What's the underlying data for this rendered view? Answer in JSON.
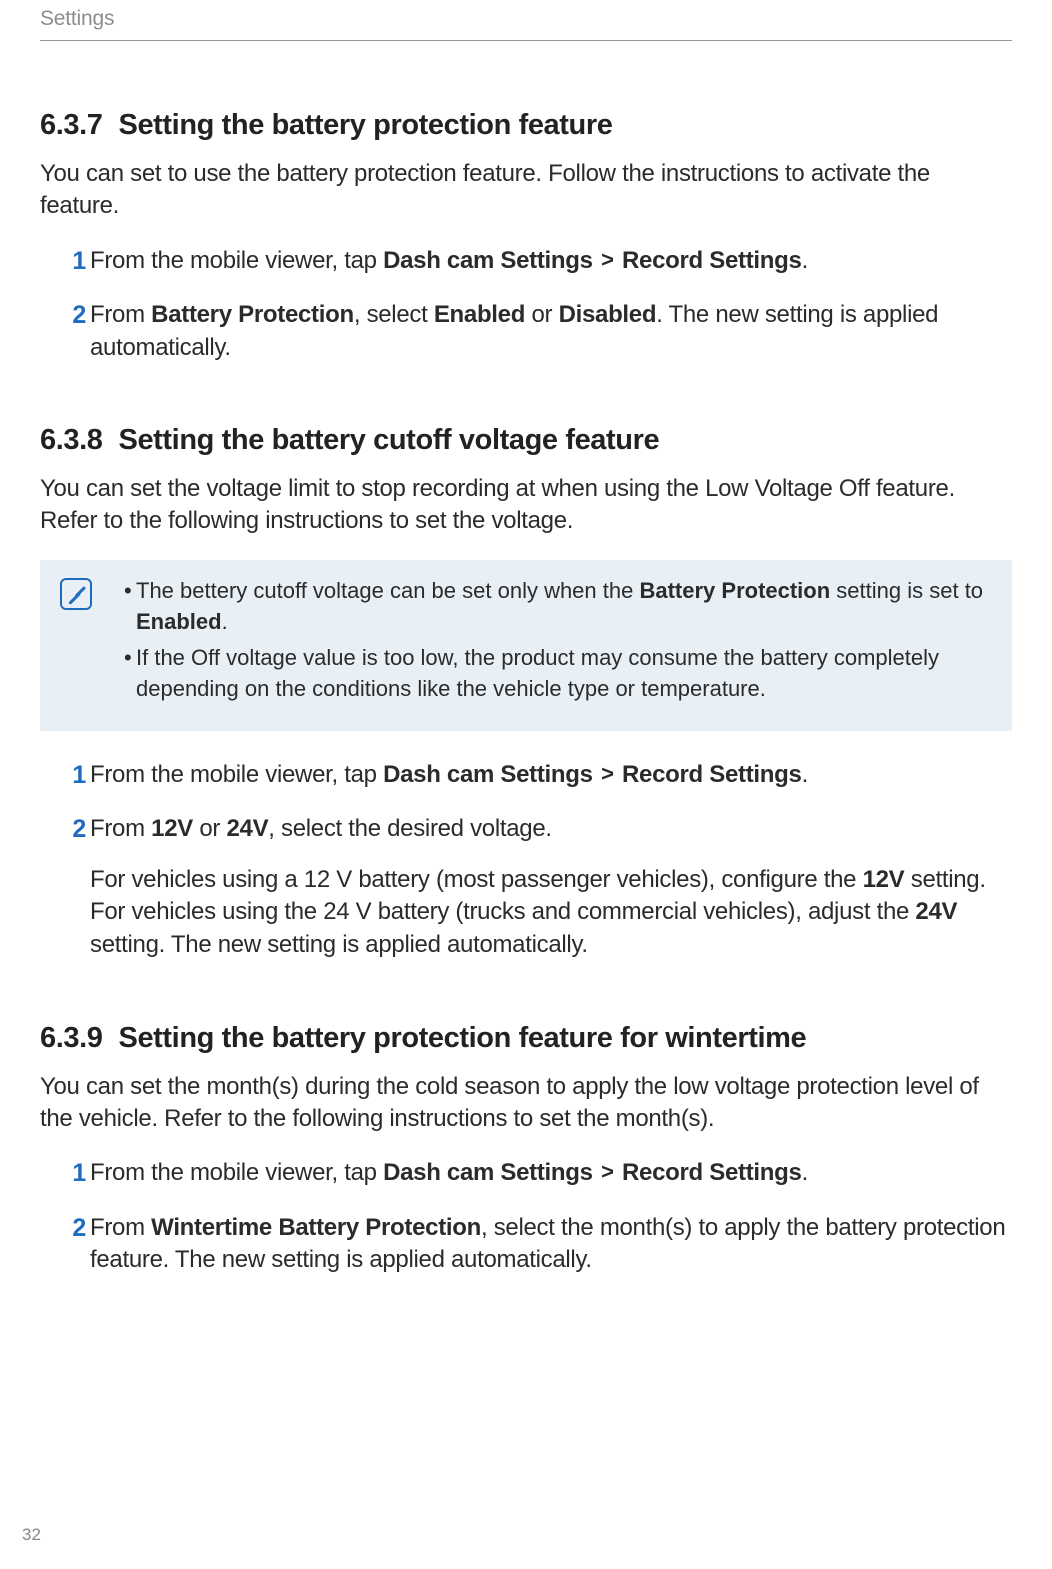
{
  "header": {
    "breadcrumb": "Settings"
  },
  "sections": [
    {
      "num": "6.3.7",
      "title": "Setting the battery protection feature",
      "intro": "You can set to use the battery protection feature. Follow the instructions to activate the feature.",
      "steps": [
        {
          "num": "1",
          "pre": "From the mobile viewer, tap ",
          "bold1": "Dash cam Settings",
          "chev": ">",
          "bold2": "Record Settings",
          "post": "."
        },
        {
          "num": "2",
          "pre": "From ",
          "bold1": "Battery Protection",
          "mid1": ", select ",
          "bold2": "Enabled",
          "mid2": " or ",
          "bold3": "Disabled",
          "post": ". The new setting is applied automatically."
        }
      ]
    },
    {
      "num": "6.3.8",
      "title": "Setting the battery cutoff voltage feature",
      "intro": "You can set the voltage limit to stop recording at when using the Low Voltage Off feature. Refer to the following instructions to set the voltage.",
      "note": [
        {
          "pre": "The bettery cutoff voltage can be set only when the ",
          "bold1": "Battery Protection",
          "mid1": " setting is set to ",
          "bold2": "Enabled",
          "post": "."
        },
        {
          "text": "If the Off voltage value is too low, the product may consume the battery completely depending on the conditions like the vehicle type or temperature."
        }
      ],
      "steps": [
        {
          "num": "1",
          "pre": "From the mobile viewer, tap ",
          "bold1": "Dash cam Settings",
          "chev": ">",
          "bold2": "Record Settings",
          "post": "."
        },
        {
          "num": "2",
          "pre": "From ",
          "bold1": "12V",
          "mid1": " or ",
          "bold2": "24V",
          "post": ", select the desired voltage.",
          "sub_pre": "For vehicles using a 12 V battery (most passenger vehicles), configure the ",
          "sub_b1": "12V",
          "sub_mid1": " setting. For vehicles using the 24 V battery (trucks and commercial vehicles), adjust the ",
          "sub_b2": "24V",
          "sub_post": " setting. The new setting is applied automatically."
        }
      ]
    },
    {
      "num": "6.3.9",
      "title": "Setting the battery protection feature for wintertime",
      "intro": "You can set the month(s) during the cold season to apply the low voltage protection level of the vehicle. Refer to the following instructions to set the month(s).",
      "steps": [
        {
          "num": "1",
          "pre": "From the mobile viewer, tap ",
          "bold1": "Dash cam Settings",
          "chev": ">",
          "bold2": "Record Settings",
          "post": "."
        },
        {
          "num": "2",
          "pre": "From ",
          "bold1": "Wintertime Battery Protection",
          "post": ", select the month(s) to apply the battery protection feature. The new setting is applied automatically."
        }
      ]
    }
  ],
  "page_number": "32"
}
